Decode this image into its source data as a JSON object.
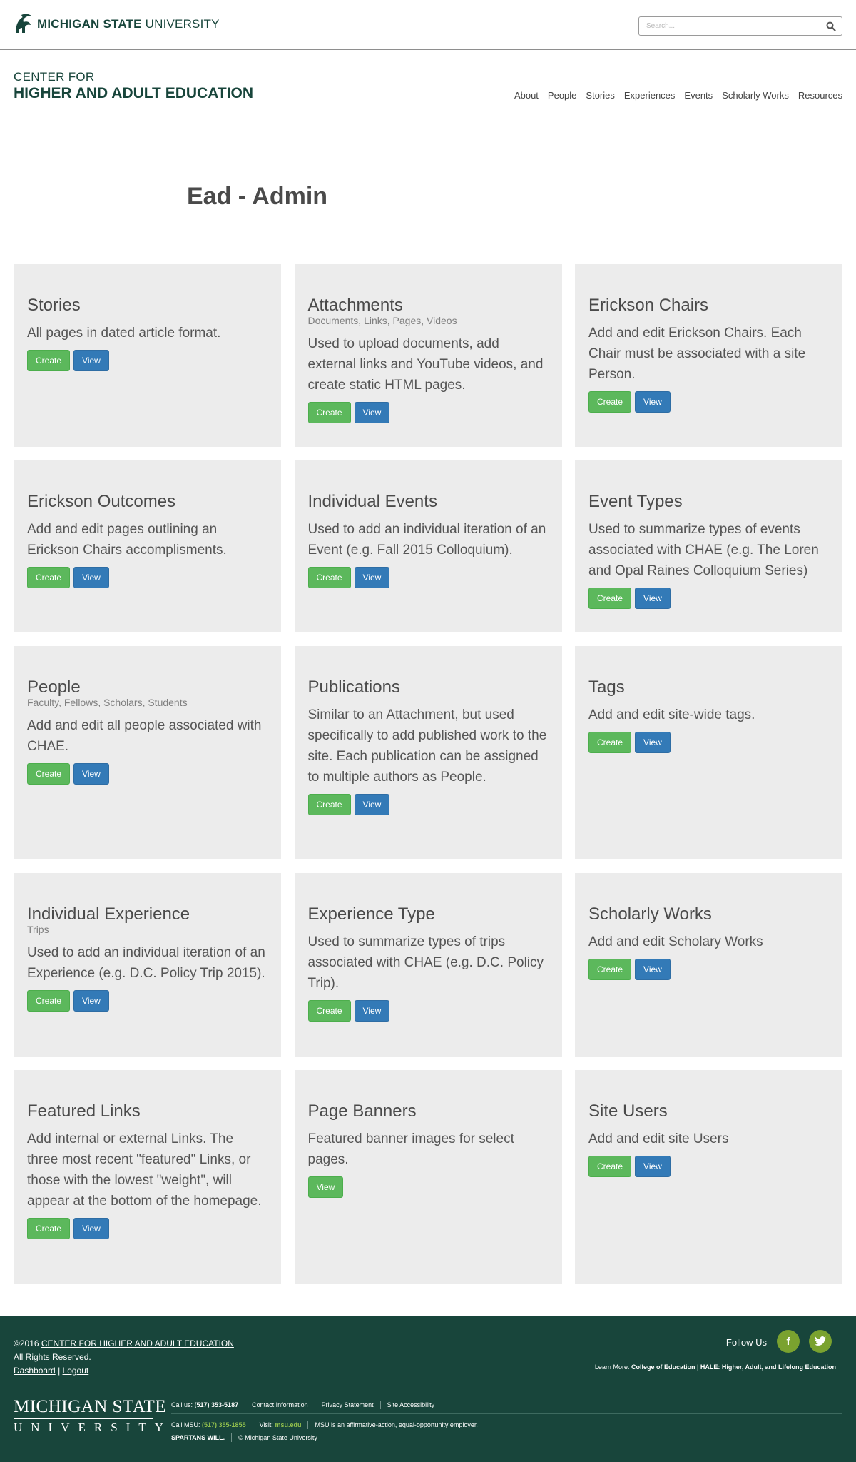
{
  "topbar": {
    "brand_bold": "MICHIGAN STATE",
    "brand_light": "UNIVERSITY",
    "search_placeholder": "Search..."
  },
  "header": {
    "unit_line1": "CENTER FOR",
    "unit_line2": "HIGHER AND ADULT EDUCATION",
    "nav": [
      "About",
      "People",
      "Stories",
      "Experiences",
      "Events",
      "Scholarly Works",
      "Resources"
    ]
  },
  "page": {
    "title": "Ead - Admin"
  },
  "cards": [
    {
      "title": "Stories",
      "sub": "",
      "desc": "All pages in dated article format.",
      "create": "Create",
      "view": "View"
    },
    {
      "title": "Attachments",
      "sub": "Documents, Links, Pages, Videos",
      "desc": "Used to upload documents, add external links and YouTube videos, and create static HTML pages.",
      "create": "Create",
      "view": "View"
    },
    {
      "title": "Erickson Chairs",
      "sub": "",
      "desc": "Add and edit Erickson Chairs. Each Chair must be associated with a site Person.",
      "create": "Create",
      "view": "View"
    },
    {
      "title": "Erickson Outcomes",
      "sub": "",
      "desc": "Add and edit pages outlining an Erickson Chairs accomplisments.",
      "create": "Create",
      "view": "View"
    },
    {
      "title": "Individual Events",
      "sub": "",
      "desc": "Used to add an individual iteration of an Event (e.g. Fall 2015 Colloquium).",
      "create": "Create",
      "view": "View"
    },
    {
      "title": "Event Types",
      "sub": "",
      "desc": "Used to summarize types of events associated with CHAE (e.g. The Loren and Opal Raines Colloquium Series)",
      "create": "Create",
      "view": "View"
    },
    {
      "title": "People",
      "sub": "Faculty, Fellows, Scholars, Students",
      "desc": "Add and edit all people associated with CHAE.",
      "create": "Create",
      "view": "View"
    },
    {
      "title": "Publications",
      "sub": "",
      "desc": "Similar to an Attachment, but used specifically to add published work to the site. Each publication can be assigned to multiple authors as People.",
      "create": "Create",
      "view": "View"
    },
    {
      "title": "Tags",
      "sub": "",
      "desc": "Add and edit site-wide tags.",
      "create": "Create",
      "view": "View"
    },
    {
      "title": "Individual Experience",
      "sub": "Trips",
      "desc": "Used to add an individual iteration of an Experience (e.g. D.C. Policy Trip 2015).",
      "create": "Create",
      "view": "View"
    },
    {
      "title": "Experience Type",
      "sub": "",
      "desc": "Used to summarize types of trips associated with CHAE (e.g. D.C. Policy Trip).",
      "create": "Create",
      "view": "View"
    },
    {
      "title": "Scholarly Works",
      "sub": "",
      "desc": "Add and edit Scholary Works",
      "create": "Create",
      "view": "View"
    },
    {
      "title": "Featured Links",
      "sub": "",
      "desc": "Add internal or external Links. The three most recent \"featured\" Links, or those with the lowest \"weight\", will appear at the bottom of the homepage.",
      "create": "Create",
      "view": "View"
    },
    {
      "title": "Page Banners",
      "sub": "",
      "desc": "Featured banner images for select pages.",
      "create": "",
      "view": "View"
    },
    {
      "title": "Site Users",
      "sub": "",
      "desc": "Add and edit site Users",
      "create": "Create",
      "view": "View"
    }
  ],
  "footer": {
    "copyright_prefix": "©2016",
    "copyright_link": "CENTER FOR HIGHER AND ADULT EDUCATION",
    "rights": "All Rights Reserved.",
    "dashboard": "Dashboard",
    "pipe": "|",
    "logout": "Logout",
    "follow": "Follow Us",
    "facebook_glyph": "f",
    "twitter_glyph": "t",
    "learn_prefix": "Learn More:",
    "learn_coe": "College of Education",
    "learn_hale": "HALE: Higher, Adult, and Lifelong Education",
    "msu_word_top": "MICHIGAN STATE",
    "msu_word_bottom": "UNIVERSITY",
    "call_us_label": "Call us:",
    "call_us_number": "(517) 353-5187",
    "contact": "Contact Information",
    "privacy": "Privacy Statement",
    "accessibility": "Site Accessibility",
    "call_msu_label": "Call MSU:",
    "call_msu_number": "(517) 355-1855",
    "visit_label": "Visit:",
    "visit_link": "msu.edu",
    "eeo": "MSU is an affirmative-action, equal-opportunity employer.",
    "spartans": "SPARTANS WILL.",
    "msu_copyright": "© Michigan State University"
  },
  "colors": {
    "msu_green": "#18453b",
    "create_button": "#5cb85c",
    "view_button": "#337ab7",
    "card_bg": "#ececec",
    "social_bg": "#7aa22f"
  }
}
